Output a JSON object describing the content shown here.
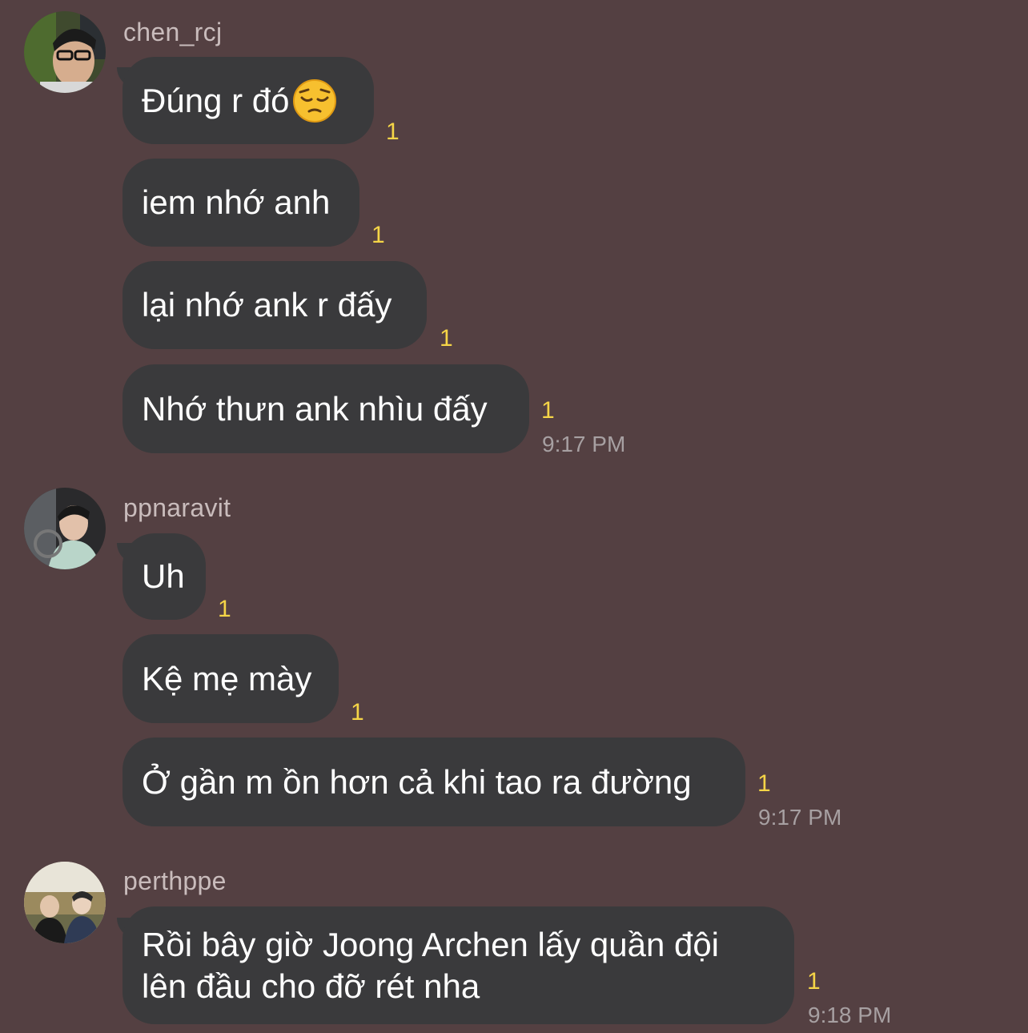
{
  "groups": [
    {
      "username": "chen_rcj",
      "avatar": "user-photo-avatar",
      "messages": [
        {
          "text": "Đúng r đó",
          "emoji": "pensive-face-emoji",
          "read": "1"
        },
        {
          "text": "iem nhớ anh",
          "read": "1"
        },
        {
          "text": "lại nhớ ank r đấy",
          "read": "1"
        },
        {
          "text": "Nhớ thưn ank nhìu đấy",
          "read": "1",
          "time": "9:17 PM"
        }
      ]
    },
    {
      "username": "ppnaravit",
      "avatar": "user-photo-avatar",
      "messages": [
        {
          "text": "Uh",
          "read": "1"
        },
        {
          "text": "Kệ mẹ mày",
          "read": "1"
        },
        {
          "text": "Ở gần m ồn hơn cả khi tao ra đường",
          "read": "1",
          "time": "9:17 PM"
        }
      ]
    },
    {
      "username": "perthppe",
      "avatar": "user-photo-avatar",
      "messages": [
        {
          "line1": "Rồi bây giờ Joong Archen lấy quần đội",
          "line2": "lên đầu cho đỡ rét nha",
          "read": "1",
          "time": "9:18 PM"
        }
      ]
    }
  ],
  "colors": {
    "background": "#544042",
    "bubble": "#3a3a3c",
    "read_indicator": "#f5d547",
    "username": "#c9bcbc",
    "timestamp": "#a7a0a2"
  }
}
